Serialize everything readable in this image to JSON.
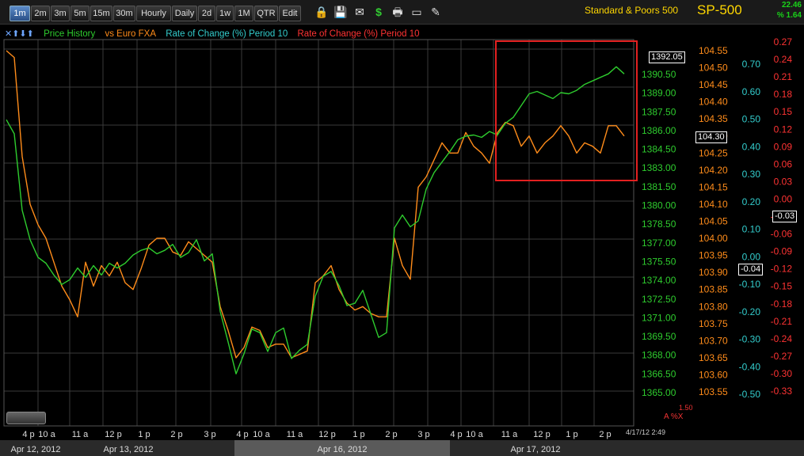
{
  "toolbar": {
    "timeframes": [
      "1m",
      "2m",
      "3m",
      "5m",
      "15m",
      "30m",
      "Hourly",
      "Daily",
      "2d",
      "1w",
      "1M",
      "QTR",
      "Edit"
    ],
    "active": "1m",
    "icons": [
      "lock-icon",
      "save-icon",
      "mail-icon",
      "dollar-icon",
      "print-icon",
      "window-icon",
      "pencil-icon"
    ]
  },
  "header": {
    "title": "Standard & Poors 500",
    "symbol": "SP-500",
    "change_value": "22.46",
    "change_pct": "% 1.64"
  },
  "legend": {
    "arrows": "✕⬆⬇⬆",
    "items": [
      {
        "label": "Price History",
        "color": "#2ecc2e"
      },
      {
        "label": "vs Euro FXA",
        "color": "#ff8c1a"
      },
      {
        "label": "Rate of Change (%) Period 10",
        "color": "#33cccc"
      },
      {
        "label": "Rate of Change (%) Period 10",
        "color": "#ff3333"
      }
    ]
  },
  "colors": {
    "price": "#2ecc2e",
    "euro": "#ff8c1a",
    "roc_cyan": "#33cccc",
    "roc_red": "#ff3333",
    "highlight_box": "#e32020",
    "grid": "#3a3a3a"
  },
  "chart_data": {
    "type": "line",
    "series": [
      {
        "name": "Price History",
        "axis": "price",
        "values": [
          1388.2,
          1387.0,
          1380.5,
          1378.0,
          1376.5,
          1376.0,
          1375.0,
          1374.2,
          1374.6,
          1375.6,
          1374.8,
          1375.8,
          1375.0,
          1376.0,
          1375.6,
          1376.0,
          1376.7,
          1377.1,
          1377.3,
          1376.8,
          1377.1,
          1377.6,
          1376.5,
          1376.9,
          1378.0,
          1376.2,
          1376.8,
          1371.9,
          1369.3,
          1366.6,
          1368.3,
          1370.4,
          1370.1,
          1368.5,
          1370.1,
          1370.5,
          1367.9,
          1368.6,
          1369.1,
          1373.2,
          1374.9,
          1375.3,
          1374.1,
          1372.4,
          1372.6,
          1373.7,
          1371.7,
          1369.7,
          1370.1,
          1379.0,
          1380.1,
          1379.1,
          1379.6,
          1382.3,
          1383.7,
          1384.6,
          1385.5,
          1386.5,
          1386.8,
          1386.9,
          1386.7,
          1387.2,
          1386.9,
          1387.9,
          1388.4,
          1389.4,
          1390.4,
          1390.6,
          1390.3,
          1390.0,
          1390.5,
          1390.4,
          1390.7,
          1391.2,
          1391.5,
          1391.8,
          1392.1,
          1392.7,
          1392.1
        ]
      },
      {
        "name": "vs Euro FXA",
        "axis": "euro",
        "values": [
          104.55,
          104.53,
          104.24,
          104.1,
          104.04,
          104.0,
          103.93,
          103.86,
          103.82,
          103.77,
          103.93,
          103.86,
          103.92,
          103.89,
          103.93,
          103.87,
          103.85,
          103.91,
          103.98,
          104.0,
          104.0,
          103.96,
          103.95,
          103.99,
          103.97,
          103.95,
          103.93,
          103.8,
          103.73,
          103.65,
          103.68,
          103.74,
          103.73,
          103.68,
          103.69,
          103.69,
          103.65,
          103.66,
          103.67,
          103.87,
          103.89,
          103.92,
          103.85,
          103.81,
          103.79,
          103.8,
          103.78,
          103.77,
          103.77,
          104.0,
          103.92,
          103.88,
          104.15,
          104.18,
          104.23,
          104.28,
          104.25,
          104.25,
          104.31,
          104.27,
          104.25,
          104.22,
          104.31,
          104.34,
          104.33,
          104.27,
          104.3,
          104.25,
          104.28,
          104.3,
          104.33,
          104.3,
          104.25,
          104.28,
          104.27,
          104.25,
          104.33,
          104.33,
          104.3
        ]
      }
    ],
    "axes": {
      "price": {
        "min": 1365,
        "max": 1392.05,
        "ticks": [
          "1390.50",
          "1389.00",
          "1387.50",
          "1386.00",
          "1384.50",
          "1383.00",
          "1381.50",
          "1380.00",
          "1378.50",
          "1377.00",
          "1375.50",
          "1374.00",
          "1372.50",
          "1371.00",
          "1369.50",
          "1368.00",
          "1366.50",
          "1365.00"
        ]
      },
      "euro": {
        "min": 103.55,
        "max": 104.55,
        "ticks": [
          "104.55",
          "104.50",
          "104.45",
          "104.40",
          "104.35",
          "104.30",
          "104.25",
          "104.20",
          "104.15",
          "104.10",
          "104.05",
          "104.00",
          "103.95",
          "103.90",
          "103.85",
          "103.80",
          "103.75",
          "103.70",
          "103.65",
          "103.60",
          "103.55"
        ]
      },
      "roc_cyan": {
        "min": -0.5,
        "max": 0.7,
        "ticks": [
          "0.70",
          "0.60",
          "0.50",
          "0.40",
          "0.30",
          "0.20",
          "0.10",
          "0.00",
          "-0.10",
          "-0.20",
          "-0.30",
          "-0.40",
          "-0.50"
        ]
      },
      "roc_red": {
        "min": -0.33,
        "max": 0.27,
        "ticks": [
          "0.27",
          "0.24",
          "0.21",
          "0.18",
          "0.15",
          "0.12",
          "0.09",
          "0.06",
          "0.03",
          "0.00",
          "-0.03",
          "-0.06",
          "-0.09",
          "-0.12",
          "-0.15",
          "-0.18",
          "-0.21",
          "-0.24",
          "-0.27",
          "-0.30",
          "-0.33"
        ]
      }
    },
    "readouts": {
      "price": "1392.05",
      "euro": "104.30",
      "roc_cyan": "-0.04",
      "roc_red": "-0.03"
    },
    "time_ticks": [
      "4 p",
      "10 a",
      "11 a",
      "12 p",
      "1 p",
      "2 p",
      "3 p",
      "4 p",
      "10 a",
      "11 a",
      "12 p",
      "1 p",
      "2 p",
      "3 p",
      "4 p",
      "10 a",
      "11 a",
      "12 p",
      "1 p",
      "2 p"
    ],
    "dates": [
      "Apr 12, 2012",
      "Apr 13, 2012",
      "Apr 16, 2012",
      "Apr 17, 2012"
    ],
    "grid": true
  },
  "footer": {
    "timestamp": "4/17/12 2:49",
    "misc_top": "1.50",
    "misc": "A %X"
  }
}
